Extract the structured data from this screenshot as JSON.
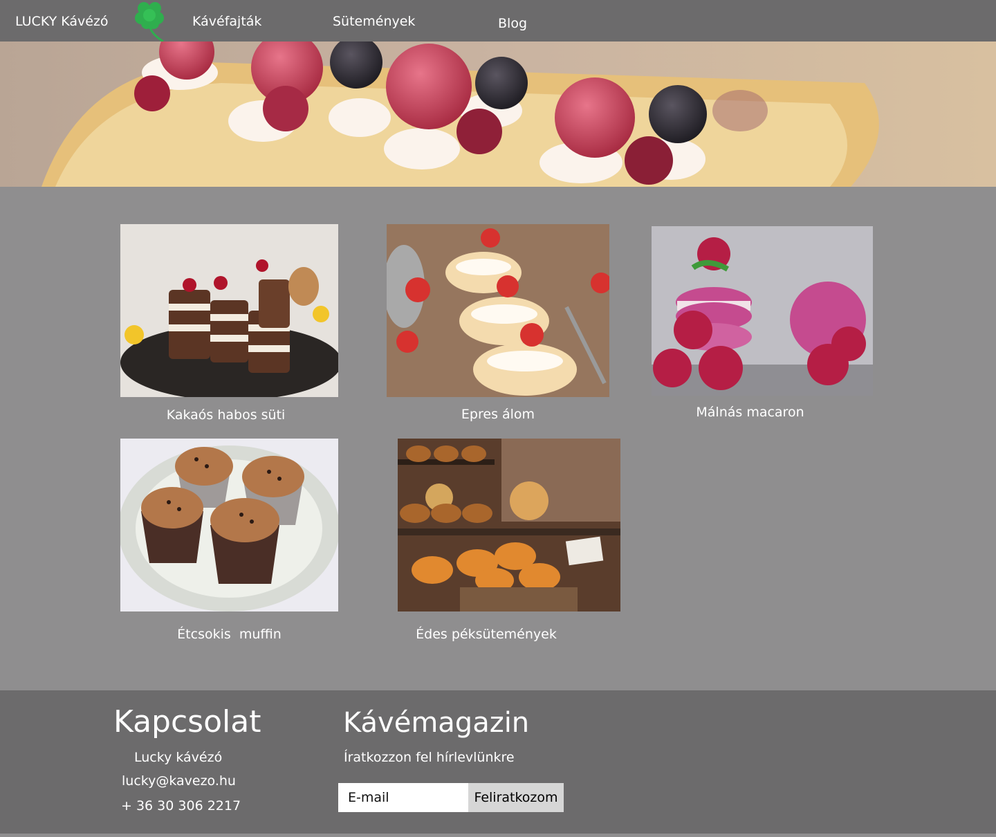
{
  "nav": {
    "brand": "LUCKY Kávézó",
    "logo_icon": "four-leaf-clover-icon",
    "links": [
      "Kávéfajták",
      "Sütemények",
      "Blog"
    ]
  },
  "hero": {
    "image": "raspberry-cake-photo"
  },
  "products": [
    {
      "name": "Kakaós habos süti",
      "image": "chocolate-cream-cakes-photo"
    },
    {
      "name": "Epres álom",
      "image": "strawberry-eclairs-photo"
    },
    {
      "name": "Málnás macaron",
      "image": "raspberry-macaron-photo"
    },
    {
      "name": "Étcsokis  muffin",
      "image": "dark-chocolate-muffins-photo"
    },
    {
      "name": "Édes péksütemények",
      "image": "bakery-pastries-photo"
    }
  ],
  "footer": {
    "contact": {
      "title": "Kapcsolat",
      "name": "Lucky kávézó",
      "email": "lucky@kavezo.hu",
      "phone": "+ 36 30 306 2217"
    },
    "magazine": {
      "title": "Kávémagazin",
      "subtitle": "Íratkozzon fel hírlevlünkre",
      "email_placeholder": "E-mail",
      "button_label": "Feliratkozom"
    }
  },
  "colors": {
    "navbar": "#6c6b6c",
    "page_background": "#8f8e8f",
    "footer": "#6c6b6c",
    "clover": "#2fae4e",
    "button": "#d6d6d6"
  }
}
